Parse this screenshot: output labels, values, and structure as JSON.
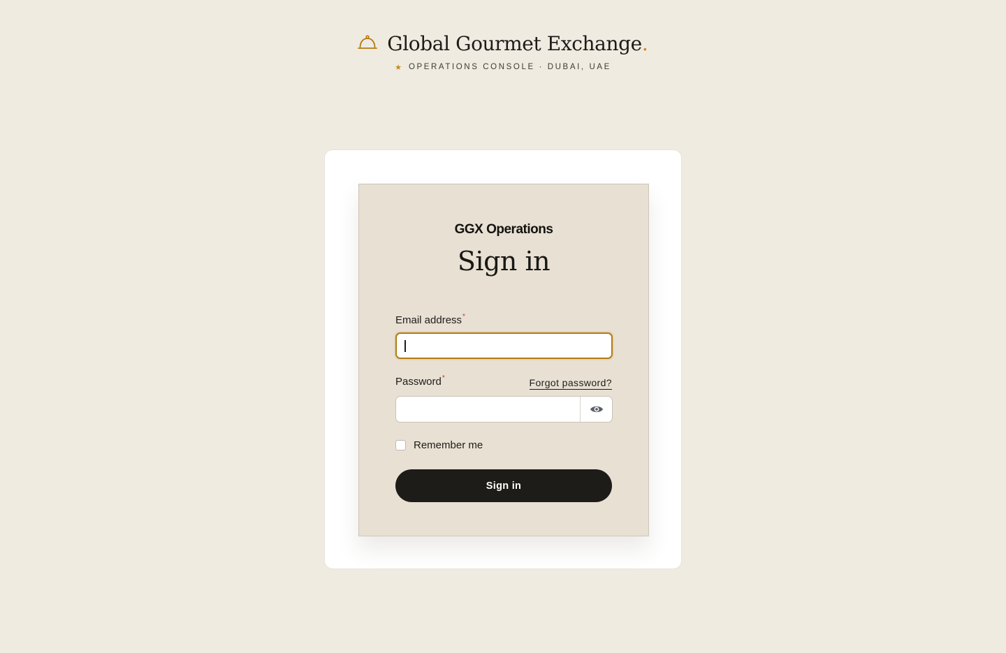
{
  "brand": {
    "title": "Global Gourmet Exchange",
    "dot": ".",
    "subtitle": "OPERATIONS CONSOLE · DUBAI, UAE",
    "logo_icon": "cloche-icon",
    "star_icon": "star-icon",
    "accent_color": "#c58a18"
  },
  "login": {
    "app_name": "GGX Operations",
    "heading": "Sign in",
    "email": {
      "label": "Email address",
      "required_marker": "*",
      "value": ""
    },
    "password": {
      "label": "Password",
      "required_marker": "*",
      "value": "",
      "toggle_icon": "eye-icon"
    },
    "forgot_password": "Forgot password?",
    "remember_me": {
      "label": "Remember me",
      "checked": false
    },
    "submit_label": "Sign in",
    "button_color": "#1d1c19"
  }
}
